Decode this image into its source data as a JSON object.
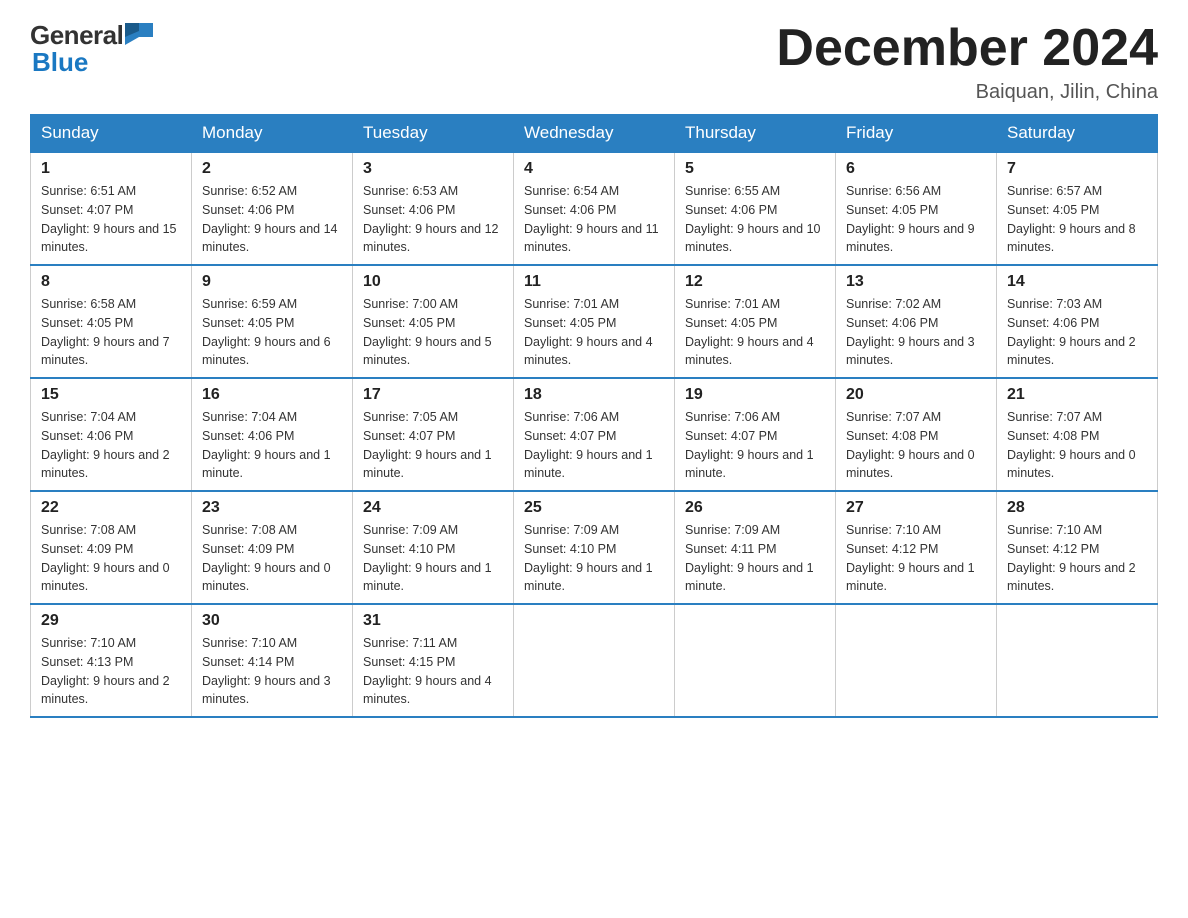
{
  "logo": {
    "general": "General",
    "blue": "Blue"
  },
  "header": {
    "month": "December 2024",
    "location": "Baiquan, Jilin, China"
  },
  "weekdays": [
    "Sunday",
    "Monday",
    "Tuesday",
    "Wednesday",
    "Thursday",
    "Friday",
    "Saturday"
  ],
  "weeks": [
    [
      {
        "day": "1",
        "sunrise": "6:51 AM",
        "sunset": "4:07 PM",
        "daylight": "9 hours and 15 minutes."
      },
      {
        "day": "2",
        "sunrise": "6:52 AM",
        "sunset": "4:06 PM",
        "daylight": "9 hours and 14 minutes."
      },
      {
        "day": "3",
        "sunrise": "6:53 AM",
        "sunset": "4:06 PM",
        "daylight": "9 hours and 12 minutes."
      },
      {
        "day": "4",
        "sunrise": "6:54 AM",
        "sunset": "4:06 PM",
        "daylight": "9 hours and 11 minutes."
      },
      {
        "day": "5",
        "sunrise": "6:55 AM",
        "sunset": "4:06 PM",
        "daylight": "9 hours and 10 minutes."
      },
      {
        "day": "6",
        "sunrise": "6:56 AM",
        "sunset": "4:05 PM",
        "daylight": "9 hours and 9 minutes."
      },
      {
        "day": "7",
        "sunrise": "6:57 AM",
        "sunset": "4:05 PM",
        "daylight": "9 hours and 8 minutes."
      }
    ],
    [
      {
        "day": "8",
        "sunrise": "6:58 AM",
        "sunset": "4:05 PM",
        "daylight": "9 hours and 7 minutes."
      },
      {
        "day": "9",
        "sunrise": "6:59 AM",
        "sunset": "4:05 PM",
        "daylight": "9 hours and 6 minutes."
      },
      {
        "day": "10",
        "sunrise": "7:00 AM",
        "sunset": "4:05 PM",
        "daylight": "9 hours and 5 minutes."
      },
      {
        "day": "11",
        "sunrise": "7:01 AM",
        "sunset": "4:05 PM",
        "daylight": "9 hours and 4 minutes."
      },
      {
        "day": "12",
        "sunrise": "7:01 AM",
        "sunset": "4:05 PM",
        "daylight": "9 hours and 4 minutes."
      },
      {
        "day": "13",
        "sunrise": "7:02 AM",
        "sunset": "4:06 PM",
        "daylight": "9 hours and 3 minutes."
      },
      {
        "day": "14",
        "sunrise": "7:03 AM",
        "sunset": "4:06 PM",
        "daylight": "9 hours and 2 minutes."
      }
    ],
    [
      {
        "day": "15",
        "sunrise": "7:04 AM",
        "sunset": "4:06 PM",
        "daylight": "9 hours and 2 minutes."
      },
      {
        "day": "16",
        "sunrise": "7:04 AM",
        "sunset": "4:06 PM",
        "daylight": "9 hours and 1 minute."
      },
      {
        "day": "17",
        "sunrise": "7:05 AM",
        "sunset": "4:07 PM",
        "daylight": "9 hours and 1 minute."
      },
      {
        "day": "18",
        "sunrise": "7:06 AM",
        "sunset": "4:07 PM",
        "daylight": "9 hours and 1 minute."
      },
      {
        "day": "19",
        "sunrise": "7:06 AM",
        "sunset": "4:07 PM",
        "daylight": "9 hours and 1 minute."
      },
      {
        "day": "20",
        "sunrise": "7:07 AM",
        "sunset": "4:08 PM",
        "daylight": "9 hours and 0 minutes."
      },
      {
        "day": "21",
        "sunrise": "7:07 AM",
        "sunset": "4:08 PM",
        "daylight": "9 hours and 0 minutes."
      }
    ],
    [
      {
        "day": "22",
        "sunrise": "7:08 AM",
        "sunset": "4:09 PM",
        "daylight": "9 hours and 0 minutes."
      },
      {
        "day": "23",
        "sunrise": "7:08 AM",
        "sunset": "4:09 PM",
        "daylight": "9 hours and 0 minutes."
      },
      {
        "day": "24",
        "sunrise": "7:09 AM",
        "sunset": "4:10 PM",
        "daylight": "9 hours and 1 minute."
      },
      {
        "day": "25",
        "sunrise": "7:09 AM",
        "sunset": "4:10 PM",
        "daylight": "9 hours and 1 minute."
      },
      {
        "day": "26",
        "sunrise": "7:09 AM",
        "sunset": "4:11 PM",
        "daylight": "9 hours and 1 minute."
      },
      {
        "day": "27",
        "sunrise": "7:10 AM",
        "sunset": "4:12 PM",
        "daylight": "9 hours and 1 minute."
      },
      {
        "day": "28",
        "sunrise": "7:10 AM",
        "sunset": "4:12 PM",
        "daylight": "9 hours and 2 minutes."
      }
    ],
    [
      {
        "day": "29",
        "sunrise": "7:10 AM",
        "sunset": "4:13 PM",
        "daylight": "9 hours and 2 minutes."
      },
      {
        "day": "30",
        "sunrise": "7:10 AM",
        "sunset": "4:14 PM",
        "daylight": "9 hours and 3 minutes."
      },
      {
        "day": "31",
        "sunrise": "7:11 AM",
        "sunset": "4:15 PM",
        "daylight": "9 hours and 4 minutes."
      },
      null,
      null,
      null,
      null
    ]
  ],
  "labels": {
    "sunrise": "Sunrise:",
    "sunset": "Sunset:",
    "daylight": "Daylight:"
  }
}
